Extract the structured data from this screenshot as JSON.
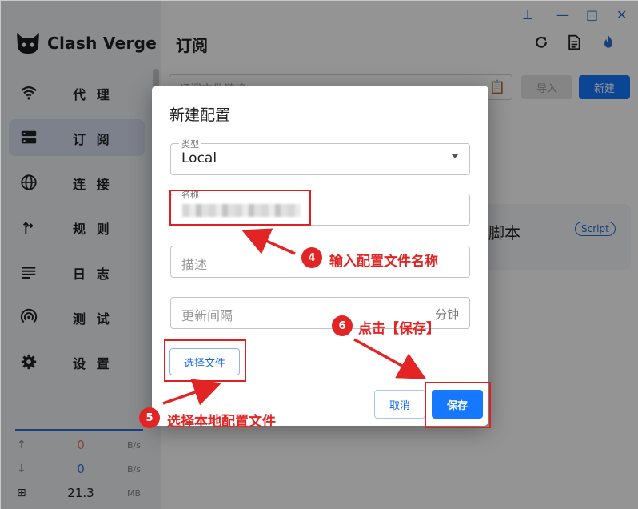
{
  "app": {
    "name": "Clash Verge"
  },
  "sidebar": {
    "items": [
      {
        "label": "代 理",
        "icon": "wifi-icon"
      },
      {
        "label": "订 阅",
        "icon": "server-icon",
        "active": true
      },
      {
        "label": "连 接",
        "icon": "globe-icon"
      },
      {
        "label": "规 则",
        "icon": "rule-fork-icon"
      },
      {
        "label": "日 志",
        "icon": "list-icon"
      },
      {
        "label": "测 试",
        "icon": "radar-icon"
      },
      {
        "label": "设 置",
        "icon": "gear-icon"
      }
    ],
    "traffic": {
      "upload": {
        "value": "0",
        "unit": "B/s",
        "color": "#e8765b"
      },
      "download": {
        "value": "0",
        "unit": "B/s",
        "color": "#2f6fe0"
      },
      "memory": {
        "value": "21.3",
        "unit": "MB"
      }
    }
  },
  "main": {
    "title": "订阅",
    "url_input_placeholder": "订阅文件链接",
    "import_button": "导入",
    "new_button": "新建",
    "profile_card": {
      "name_fragment": "脚本",
      "badge": "Script"
    }
  },
  "dialog": {
    "title": "新建配置",
    "type_field": {
      "legend": "类型",
      "value": "Local"
    },
    "name_field": {
      "legend": "名称",
      "value": ""
    },
    "desc_field": {
      "placeholder": "描述"
    },
    "interval_field": {
      "placeholder": "更新间隔",
      "suffix": "分钟"
    },
    "choose_file_button": "选择文件",
    "cancel_button": "取消",
    "save_button": "保存"
  },
  "annotations": [
    {
      "number": "4",
      "text": "输入配置文件名称"
    },
    {
      "number": "5",
      "text": "选择本地配置文件"
    },
    {
      "number": "6",
      "text": "点击【保存】"
    }
  ],
  "colors": {
    "accent": "#1677ff",
    "annotation": "#e32424",
    "sidebar_active": "#d7def0"
  }
}
